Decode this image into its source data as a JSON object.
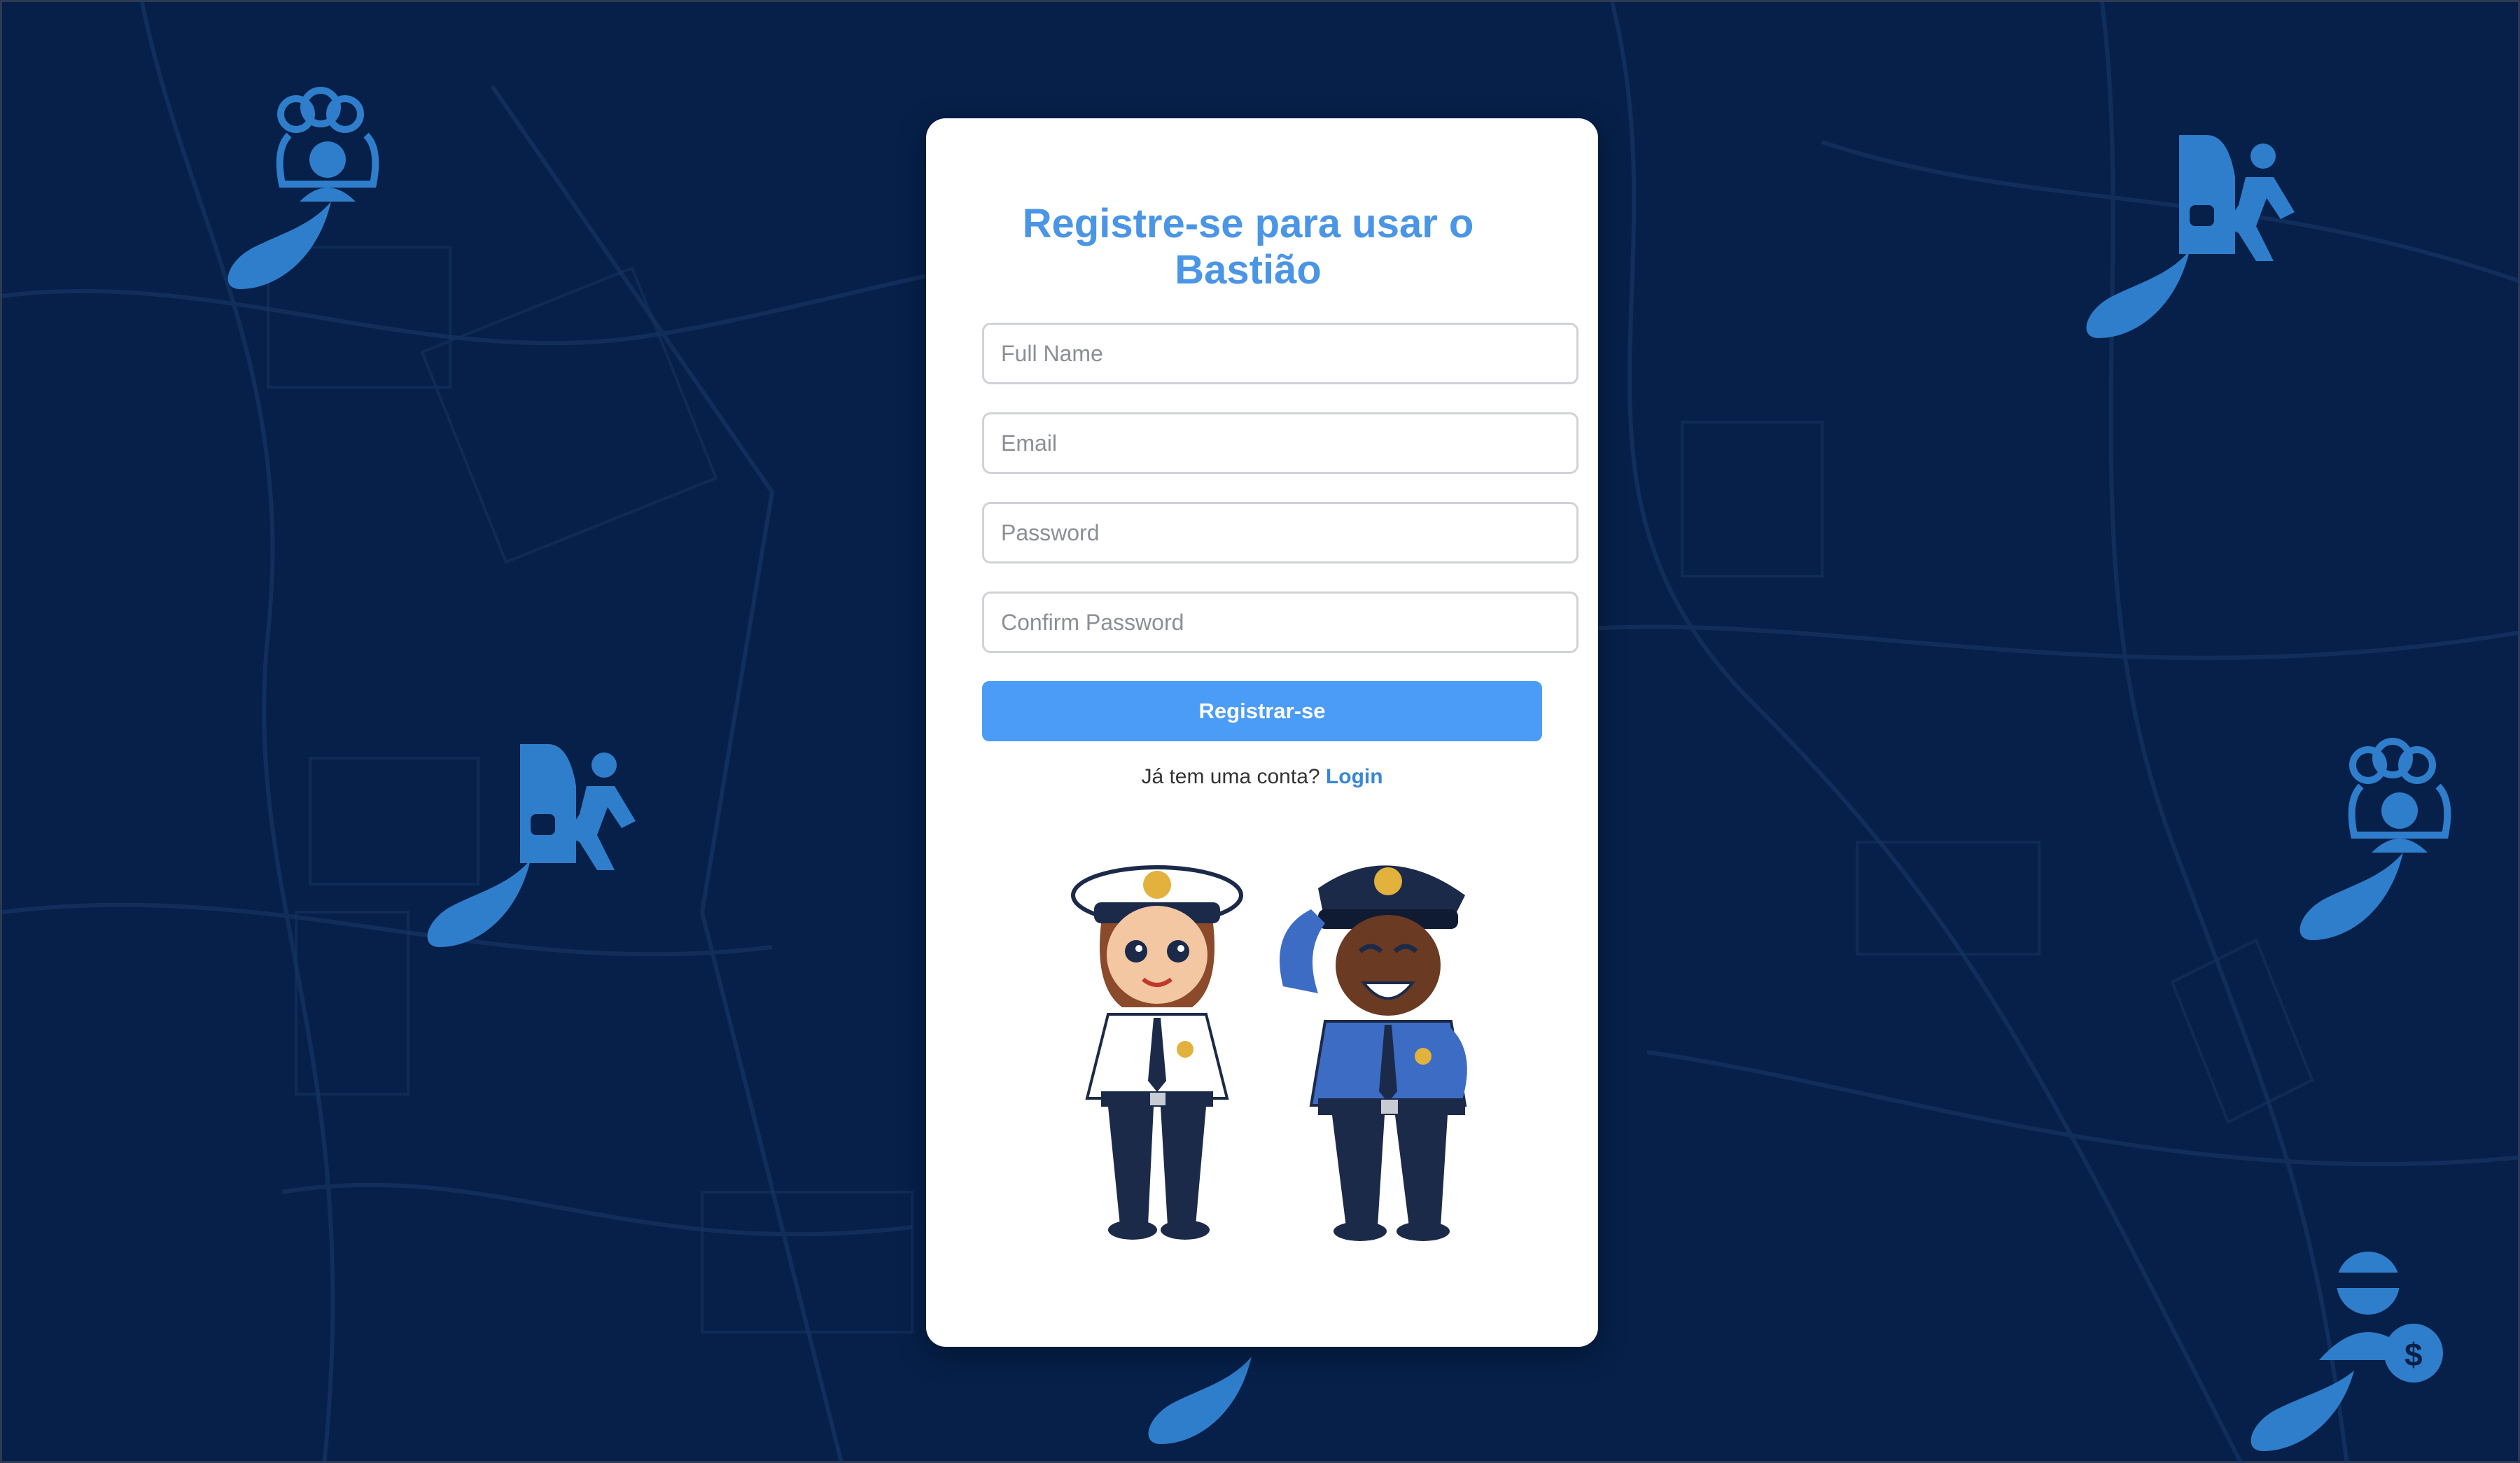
{
  "page": {
    "background_color": "#062049",
    "pin_color": "#2f7ecb"
  },
  "register_card": {
    "title": "Registre-se para usar o Bastião",
    "title_color": "#4a95e6",
    "fields": {
      "full_name": {
        "placeholder": "Full Name",
        "value": ""
      },
      "email": {
        "placeholder": "Email",
        "value": ""
      },
      "password": {
        "placeholder": "Password",
        "value": ""
      },
      "confirm_password": {
        "placeholder": "Confirm Password",
        "value": ""
      }
    },
    "submit_label": "Registrar-se",
    "submit_color": "#4a9cf7",
    "login_prompt": "Já tem uma conta?",
    "login_link": "Login",
    "illustration_icon": "police-officers-illustration"
  },
  "map_pins": [
    {
      "icon": "group-of-people-icon"
    },
    {
      "icon": "vehicle-theft-icon"
    },
    {
      "icon": "vehicle-theft-icon"
    },
    {
      "icon": "group-of-people-icon"
    },
    {
      "icon": "vehicle-theft-icon"
    },
    {
      "icon": "robber-with-money-bag-icon"
    }
  ]
}
